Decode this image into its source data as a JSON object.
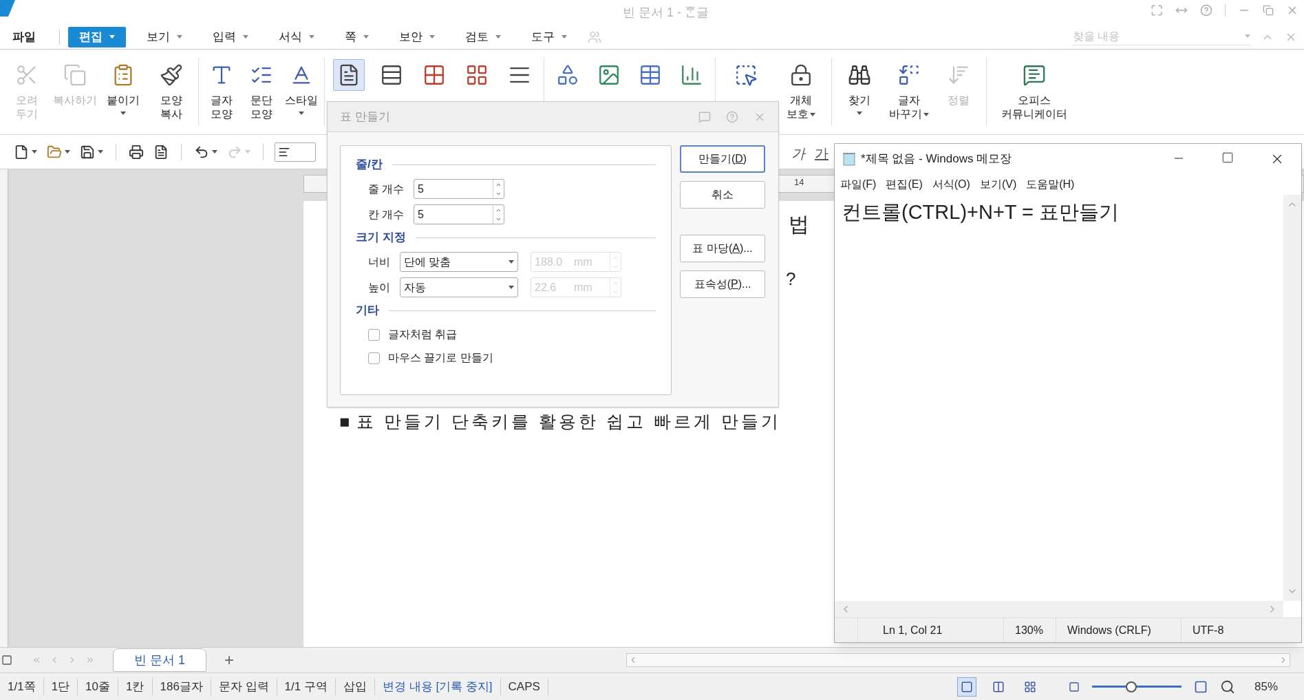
{
  "window": {
    "title": "빈 문서 1 - ᄒᆞᆫ글"
  },
  "menu": [
    {
      "label": "파일",
      "selected": false,
      "dropdown": false
    },
    {
      "label": "편집",
      "selected": true,
      "dropdown": true
    },
    {
      "label": "보기",
      "selected": false,
      "dropdown": true
    },
    {
      "label": "입력",
      "selected": false,
      "dropdown": true
    },
    {
      "label": "서식",
      "selected": false,
      "dropdown": true
    },
    {
      "label": "쪽",
      "selected": false,
      "dropdown": true
    },
    {
      "label": "보안",
      "selected": false,
      "dropdown": true
    },
    {
      "label": "검토",
      "selected": false,
      "dropdown": true
    },
    {
      "label": "도구",
      "selected": false,
      "dropdown": true
    }
  ],
  "find": {
    "placeholder": "찾을 내용"
  },
  "ribbon": [
    {
      "items": [
        {
          "lines": [
            "오려",
            "두기"
          ],
          "disabled": true,
          "dropdown": false,
          "selected": false
        },
        {
          "lines": [
            "복사하기"
          ],
          "disabled": true,
          "dropdown": false,
          "selected": false
        },
        {
          "lines": [
            "붙이기"
          ],
          "disabled": false,
          "dropdown": true,
          "selected": false
        },
        {
          "lines": [
            "모양",
            "복사"
          ],
          "disabled": false,
          "dropdown": false,
          "selected": false
        }
      ]
    },
    {
      "items": [
        {
          "lines": [
            "글자",
            "모양"
          ],
          "disabled": false,
          "dropdown": false,
          "selected": false
        },
        {
          "lines": [
            "문단",
            "모양"
          ],
          "disabled": false,
          "dropdown": false,
          "selected": false
        },
        {
          "lines": [
            "스타일"
          ],
          "disabled": false,
          "dropdown": true,
          "selected": false
        }
      ]
    },
    {
      "items": [
        {
          "disabled": false,
          "selected": true
        },
        {
          "disabled": false,
          "selected": false
        },
        {
          "disabled": false,
          "selected": false
        },
        {
          "disabled": false,
          "selected": false
        },
        {
          "disabled": false,
          "selected": false
        }
      ]
    },
    {
      "items": [
        {
          "disabled": false,
          "selected": false
        },
        {
          "disabled": false,
          "selected": false
        },
        {
          "disabled": false,
          "selected": false
        },
        {
          "disabled": false,
          "selected": false
        }
      ]
    },
    {
      "items": [
        {
          "disabled": false,
          "selected": false
        },
        {
          "lines": [
            "개체",
            "보호"
          ],
          "disabled": false,
          "dropdown": true,
          "selected": false
        }
      ]
    },
    {
      "items": [
        {
          "lines": [
            "찾기"
          ],
          "disabled": false,
          "dropdown": true,
          "selected": false
        },
        {
          "lines": [
            "글자",
            "바꾸기"
          ],
          "disabled": false,
          "dropdown": true,
          "selected": false
        },
        {
          "lines": [
            "정렬"
          ],
          "disabled": true,
          "dropdown": false,
          "selected": false
        }
      ]
    },
    {
      "items": [
        {
          "lines": [
            "오피스",
            "커뮤니케이터"
          ],
          "disabled": false,
          "dropdown": false,
          "selected": false
        }
      ]
    }
  ],
  "quick_toolbar": [
    {
      "dropdown": true,
      "disabled": false
    },
    {
      "dropdown": true,
      "disabled": false
    },
    {
      "dropdown": true,
      "disabled": false
    },
    {
      "dropdown": false,
      "disabled": false
    },
    {
      "dropdown": false,
      "disabled": false
    },
    {
      "dropdown": true,
      "disabled": false
    },
    {
      "dropdown": true,
      "disabled": true
    }
  ],
  "format_buttons": [
    {
      "label": "가",
      "kind": "italic"
    },
    {
      "label": "가",
      "kind": "underline"
    }
  ],
  "ruler_labels": [
    "14"
  ],
  "document": {
    "heading_fragment": "법",
    "question_fragment": "?",
    "bullet": "■",
    "bullet_text": "표 만들기 단축키를 활용한 쉽고 빠르게 만들기"
  },
  "dialog": {
    "title": "표 만들기",
    "rows_cols": {
      "heading": "줄/칸",
      "fields": [
        {
          "label": "줄 개수",
          "value": "5"
        },
        {
          "label": "칸 개수",
          "value": "5"
        }
      ]
    },
    "size": {
      "heading": "크기 지정",
      "fields": [
        {
          "label": "너비",
          "option": "단에 맞춤",
          "value": "188.0",
          "unit": "mm",
          "disabled": true
        },
        {
          "label": "높이",
          "option": "자동",
          "value": "22.6",
          "unit": "mm",
          "disabled": true
        }
      ]
    },
    "other": {
      "heading": "기타",
      "options": [
        {
          "label": "글자처럼 취급",
          "checked": false
        },
        {
          "label": "마우스 끌기로 만들기",
          "checked": false
        }
      ]
    },
    "button_groups": [
      {
        "buttons": [
          {
            "parts": [
              "만들기(",
              "D",
              ")"
            ],
            "default": true
          },
          {
            "parts": [
              "취소"
            ],
            "default": false
          }
        ]
      },
      {
        "buttons": [
          {
            "parts": [
              "표 마당(",
              "A",
              ")..."
            ],
            "default": false
          },
          {
            "parts": [
              "표속성(",
              "P",
              ")..."
            ],
            "default": false
          }
        ]
      }
    ]
  },
  "notepad": {
    "title": "*제목 없음 - Windows 메모장",
    "menu": [
      "파일(F)",
      "편집(E)",
      "서식(O)",
      "보기(V)",
      "도움말(H)"
    ],
    "text": "컨트롤(CTRL)+N+T = 표만들기",
    "status": [
      "Ln 1, Col 21",
      "130%",
      "Windows (CRLF)",
      "UTF-8"
    ]
  },
  "tabs": [
    {
      "label": "빈 문서 1",
      "selected": true
    }
  ],
  "add_tab": "+",
  "status_bar": [
    {
      "label": "1/1쪽",
      "kind": "plain"
    },
    {
      "label": "1단",
      "kind": "plain"
    },
    {
      "label": "10줄",
      "kind": "plain"
    },
    {
      "label": "1칸",
      "kind": "plain"
    },
    {
      "label": "186글자",
      "kind": "plain"
    },
    {
      "label": "문자 입력",
      "kind": "plain"
    },
    {
      "label": "1/1 구역",
      "kind": "plain"
    },
    {
      "label": "삽입",
      "kind": "plain"
    },
    {
      "label": "변경 내용 [기록 중지]",
      "kind": "link"
    },
    {
      "label": "CAPS",
      "kind": "plain"
    }
  ],
  "view_modes": [
    {
      "selected": true
    },
    {
      "selected": false
    },
    {
      "selected": false
    }
  ],
  "zoom": {
    "level": 0.44,
    "reading": "85%"
  }
}
